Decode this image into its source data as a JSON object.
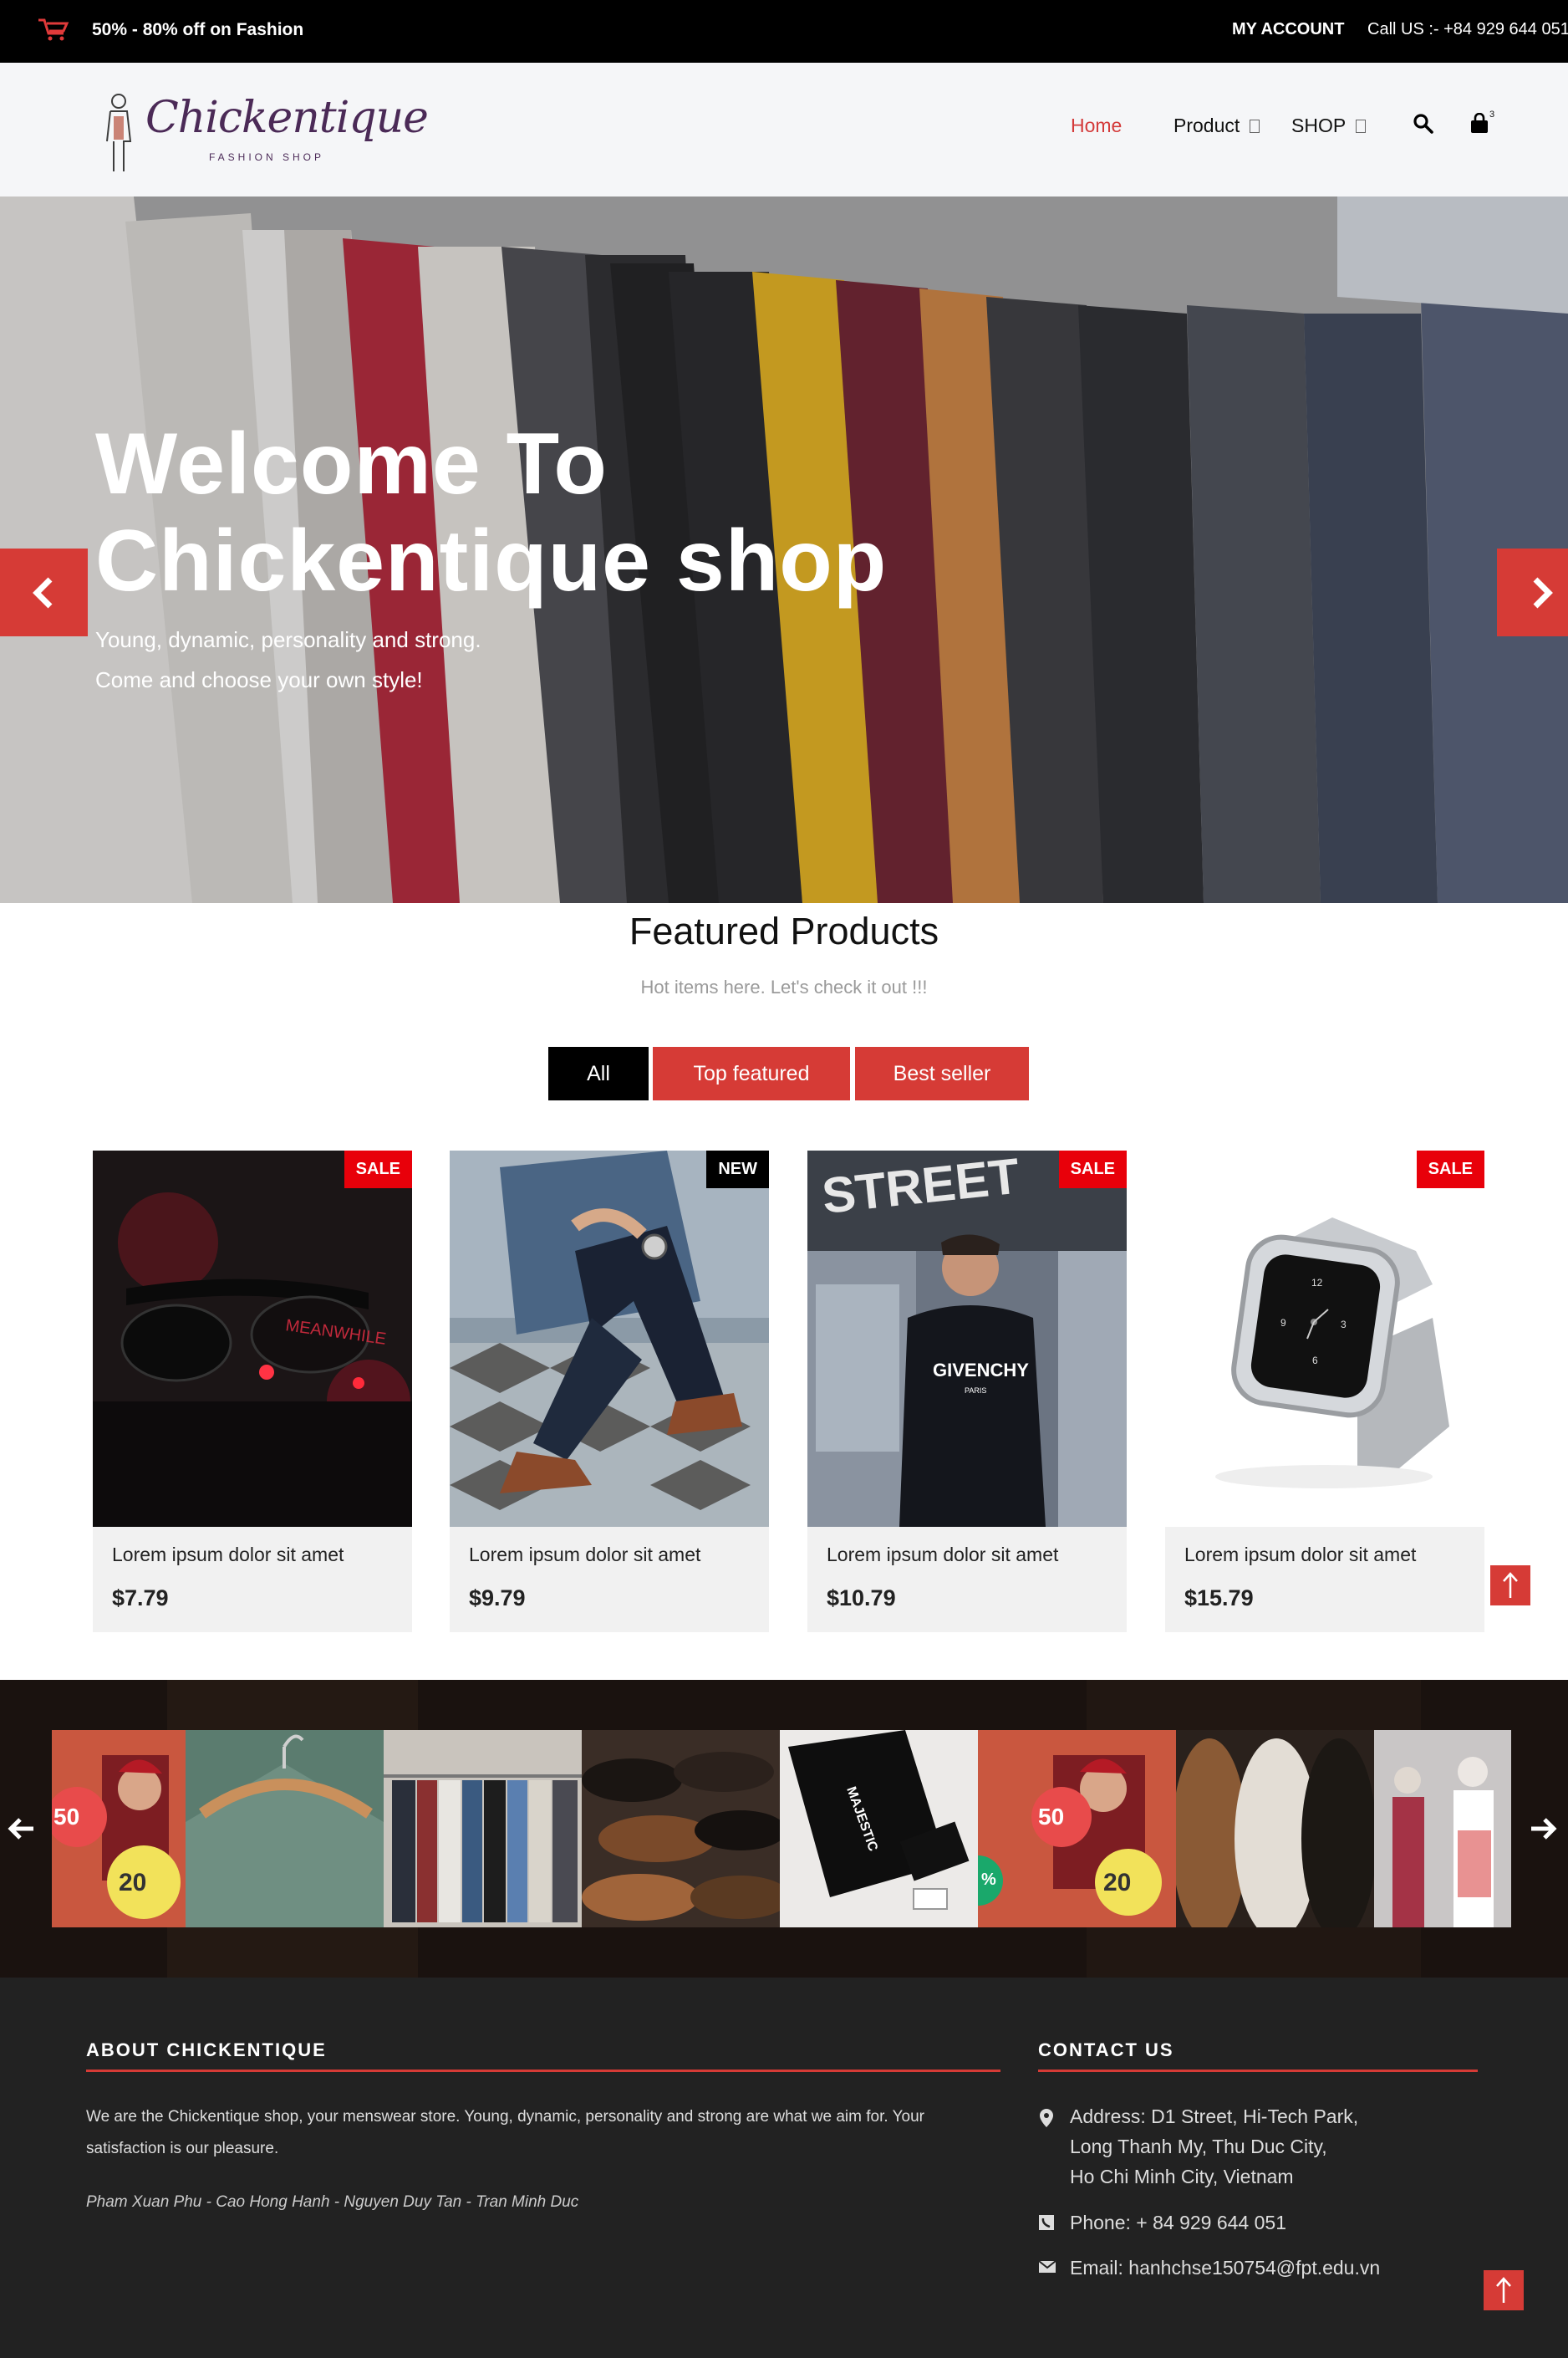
{
  "topbar": {
    "promo": "50% - 80% off on Fashion",
    "my_account": "MY ACCOUNT",
    "call_us": "Call US :- +84 929 644 051"
  },
  "header": {
    "logo_brand": "Chickentique",
    "logo_sub": "FASHION SHOP",
    "nav": {
      "home": "Home",
      "product": "Product",
      "shop": "SHOP"
    },
    "cart_count": "3"
  },
  "hero": {
    "title_line1": "Welcome To",
    "title_line2": "Chickentique shop",
    "subtitle_line1": "Young, dynamic, personality and strong.",
    "subtitle_line2": "Come and choose your own style!"
  },
  "featured": {
    "title": "Featured Products",
    "subtitle": "Hot items here. Let's check it out !!!",
    "tabs": {
      "all": "All",
      "top": "Top featured",
      "best": "Best seller"
    },
    "products": [
      {
        "badge": "SALE",
        "name": "Lorem ipsum dolor sit amet",
        "price": "$7.79"
      },
      {
        "badge": "NEW",
        "name": "Lorem ipsum dolor sit amet",
        "price": "$9.79"
      },
      {
        "badge": "SALE",
        "name": "Lorem ipsum dolor sit amet",
        "price": "$10.79"
      },
      {
        "badge": "SALE",
        "name": "Lorem ipsum dolor sit amet",
        "price": "$15.79"
      }
    ]
  },
  "gallery": {
    "tile_labels": {
      "fifty": "50",
      "twenty": "20",
      "pct": "%"
    }
  },
  "footer": {
    "about_title": "ABOUT CHICKENTIQUE",
    "about_text": "We are the Chickentique shop, your menswear store. Young, dynamic, personality and strong are what we aim for. Your satisfaction is our pleasure.",
    "authors": "Pham Xuan Phu - Cao Hong Hanh - Nguyen Duy Tan - Tran Minh Duc",
    "contact_title": "CONTACT US",
    "address_line1": "Address: D1 Street, Hi-Tech Park,",
    "address_line2": "Long Thanh My, Thu Duc City,",
    "address_line3": "Ho Chi Minh City, Vietnam",
    "phone": "Phone: + 84 929 644 051",
    "email": "Email: hanhchse150754@fpt.edu.vn"
  },
  "colors": {
    "accent": "#d63b36",
    "sale": "#e8000a",
    "dark": "#000000",
    "footer": "#222222"
  }
}
